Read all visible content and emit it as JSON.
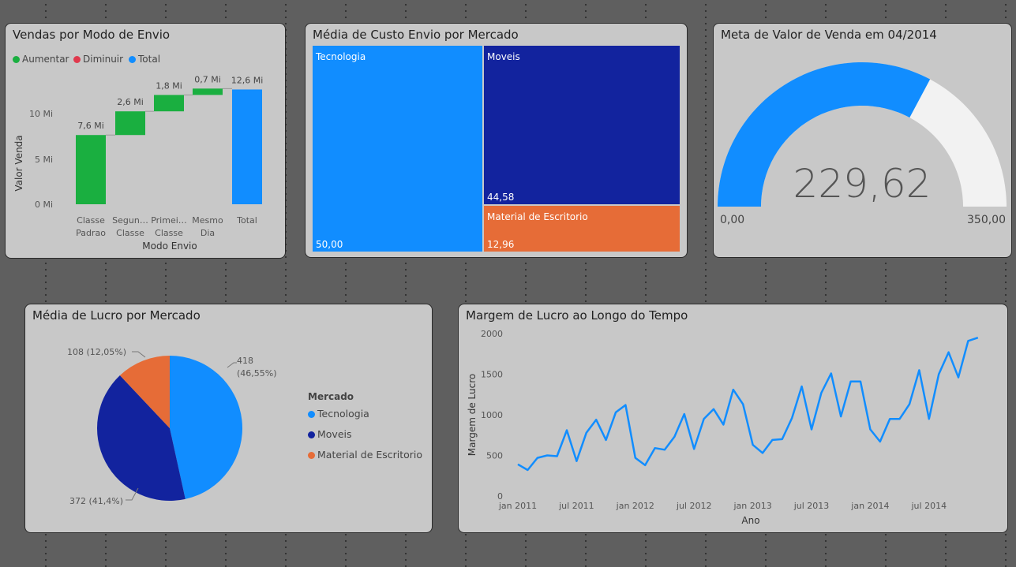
{
  "colors": {
    "increase": "#1aaf40",
    "decrease": "#e0394d",
    "total": "#118dff",
    "tecnologia": "#118dff",
    "moveis": "#12239e",
    "material": "#e66c37",
    "gauge_empty": "#f2f2f2"
  },
  "waterfall": {
    "title": "Vendas por Modo de Envio",
    "legend": [
      "Aumentar",
      "Diminuir",
      "Total"
    ],
    "ylabel": "Valor Venda",
    "xlabel": "Modo Envio",
    "yticks": [
      "0 Mi",
      "5 Mi",
      "10 Mi"
    ],
    "categories": [
      [
        "Classe",
        "Padrao"
      ],
      [
        "Segun…",
        "Classe"
      ],
      [
        "Primei…",
        "Classe"
      ],
      [
        "Mesmo",
        "Dia"
      ],
      [
        "Total"
      ]
    ],
    "labels": [
      "7,6 Mi",
      "2,6 Mi",
      "1,8 Mi",
      "0,7 Mi",
      "12,6 Mi"
    ]
  },
  "treemap": {
    "title": "Média de Custo Envio por Mercado",
    "tiles": [
      {
        "name": "Tecnologia",
        "value_label": "50,00"
      },
      {
        "name": "Moveis",
        "value_label": "44,58"
      },
      {
        "name": "Material de Escritorio",
        "value_label": "12,96"
      }
    ]
  },
  "gauge": {
    "title": "Meta de Valor de Venda em 04/2014",
    "value_label": "229,62",
    "min_label": "0,00",
    "max_label": "350,00"
  },
  "pie": {
    "title": "Média de Lucro por Mercado",
    "legend_title": "Mercado",
    "legend": [
      "Tecnologia",
      "Moveis",
      "Material de Escritorio"
    ],
    "labels": [
      [
        "418",
        "(46,55%)"
      ],
      [
        "372 (41,4%)"
      ],
      [
        "108 (12,05%)"
      ]
    ]
  },
  "line": {
    "title": "Margem de Lucro ao Longo do Tempo",
    "ylabel": "Margem de Lucro",
    "xlabel": "Ano",
    "yticks": [
      "0",
      "500",
      "1000",
      "1500",
      "2000"
    ],
    "xticks": [
      "jan 2011",
      "jul 2011",
      "jan 2012",
      "jul 2012",
      "jan 2013",
      "jul 2013",
      "jan 2014",
      "jul 2014"
    ]
  },
  "chart_data": [
    {
      "type": "bar",
      "subtype": "waterfall",
      "title": "Vendas por Modo de Envio",
      "xlabel": "Modo Envio",
      "ylabel": "Valor Venda",
      "categories": [
        "Classe Padrao",
        "Segun… Classe",
        "Primei… Classe",
        "Mesmo Dia",
        "Total"
      ],
      "values": [
        7.6,
        2.6,
        1.8,
        0.7,
        12.6
      ],
      "kinds": [
        "increase",
        "increase",
        "increase",
        "increase",
        "total"
      ],
      "unit": "Mi",
      "ylim": [
        0,
        12.6
      ],
      "legend_position": "top-left"
    },
    {
      "type": "treemap",
      "title": "Média de Custo Envio por Mercado",
      "categories": [
        "Tecnologia",
        "Moveis",
        "Material de Escritorio"
      ],
      "values": [
        50.0,
        44.58,
        12.96
      ]
    },
    {
      "type": "gauge",
      "title": "Meta de Valor de Venda em 04/2014",
      "value": 229.62,
      "min": 0,
      "max": 350
    },
    {
      "type": "pie",
      "title": "Média de Lucro por Mercado",
      "categories": [
        "Tecnologia",
        "Moveis",
        "Material de Escritorio"
      ],
      "values": [
        418,
        372,
        108
      ],
      "percents": [
        46.55,
        41.4,
        12.05
      ],
      "legend_position": "right"
    },
    {
      "type": "line",
      "title": "Margem de Lucro ao Longo do Tempo",
      "xlabel": "Ano",
      "ylabel": "Margem de Lucro",
      "ylim": [
        0,
        2000
      ],
      "x": [
        "2011-01",
        "2011-02",
        "2011-03",
        "2011-04",
        "2011-05",
        "2011-06",
        "2011-07",
        "2011-08",
        "2011-09",
        "2011-10",
        "2011-11",
        "2011-12",
        "2012-01",
        "2012-02",
        "2012-03",
        "2012-04",
        "2012-05",
        "2012-06",
        "2012-07",
        "2012-08",
        "2012-09",
        "2012-10",
        "2012-11",
        "2012-12",
        "2013-01",
        "2013-02",
        "2013-03",
        "2013-04",
        "2013-05",
        "2013-06",
        "2013-07",
        "2013-08",
        "2013-09",
        "2013-10",
        "2013-11",
        "2013-12",
        "2014-01",
        "2014-02",
        "2014-03",
        "2014-04",
        "2014-05",
        "2014-06",
        "2014-07",
        "2014-08",
        "2014-09",
        "2014-10",
        "2014-11",
        "2014-12"
      ],
      "values": [
        390,
        320,
        470,
        500,
        490,
        810,
        430,
        780,
        940,
        690,
        1030,
        1120,
        470,
        380,
        590,
        570,
        730,
        1010,
        580,
        950,
        1070,
        880,
        1310,
        1130,
        630,
        530,
        690,
        700,
        960,
        1350,
        820,
        1270,
        1510,
        980,
        1410,
        1410,
        820,
        670,
        950,
        950,
        1130,
        1550,
        950,
        1500,
        1770,
        1460,
        1910,
        1950
      ]
    }
  ]
}
